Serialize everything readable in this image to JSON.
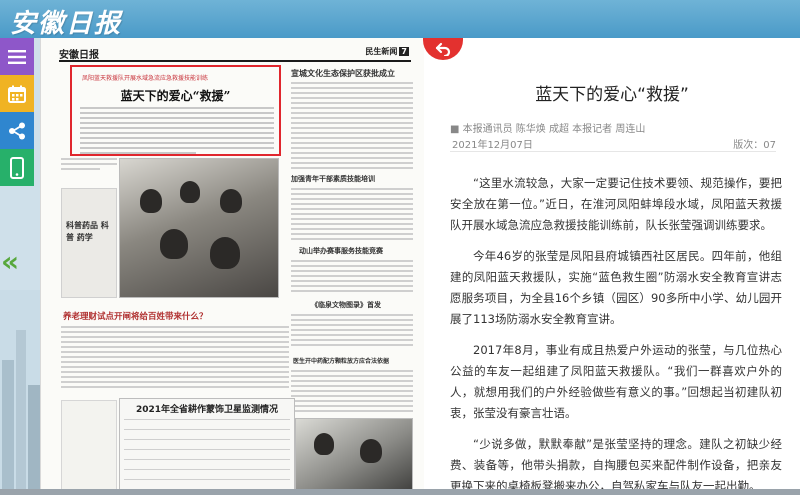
{
  "header": {
    "logo_text": "安徽日报"
  },
  "sidebar": {
    "items": [
      {
        "name": "menu-icon",
        "color": "#8e57c9"
      },
      {
        "name": "calendar-icon",
        "color": "#f0b323"
      },
      {
        "name": "share-icon",
        "color": "#2f86cf"
      },
      {
        "name": "mobile-icon",
        "color": "#27b06a"
      }
    ],
    "prev_arrows": "«"
  },
  "newspaper": {
    "logo": "安徽日报",
    "section": "民生新闻",
    "page_no": "7",
    "highlight_title": "蓝天下的爱心“救援”",
    "highlight_tag": "凤阳蓝天救援队开展水域急流应急救援技能训练",
    "side_box_title": "科普药品 科普 药学",
    "headlines": [
      "宣城文化生态保护区获批成立",
      "加强青年干部素质技能培训",
      "动山举办赛事服务技能竞赛",
      "《临泉文物图录》首发",
      "医生开中药配方颗粒放方应合法依据",
      "养老理财试点开闸将给百姓带来什么？"
    ],
    "table_title": "2021年全省耕作蒙饰卫星监测情况"
  },
  "article": {
    "title": "蓝天下的爱心“救援”",
    "authors": "■ 本报通讯员 陈华焕 成超 本报记者 周连山",
    "date": "2021年12月07日",
    "page": "版次：07",
    "paragraphs": [
      "“这里水流较急，大家一定要记住技术要领、规范操作，要把安全放在第一位。”近日，在淮河凤阳蚌埠段水域，凤阳蓝天救援队开展水域急流应急救援技能训练前，队长张莹强调训练要求。",
      "今年46岁的张莹是凤阳县府城镇西社区居民。四年前，他组建的凤阳蓝天救援队，实施“蓝色救生圈”防溺水安全教育宣讲志愿服务项目，为全县16个乡镇（园区）90多所中小学、幼儿园开展了113场防溺水安全教育宣讲。",
      "2017年8月，事业有成且热爱户外运动的张莹，与几位热心公益的车友一起组建了凤阳蓝天救援队。“我们一群喜欢户外的人，就想用我们的户外经验做些有意义的事。”回想起当初建队初衷，张莹没有豪言壮语。",
      "“少说多做，默默奉献”是张莹坚持的理念。建队之初缺少经费、装备等，他带头捐款，自掏腰包买来配件制作设备，把亲友更换下来的桌椅板凳搬来办公，自驾私家车与队友一起出勤。"
    ]
  },
  "colors": {
    "header": "#4a9ac8",
    "highlight_border": "#e0262d",
    "back_button": "#e3312f"
  }
}
